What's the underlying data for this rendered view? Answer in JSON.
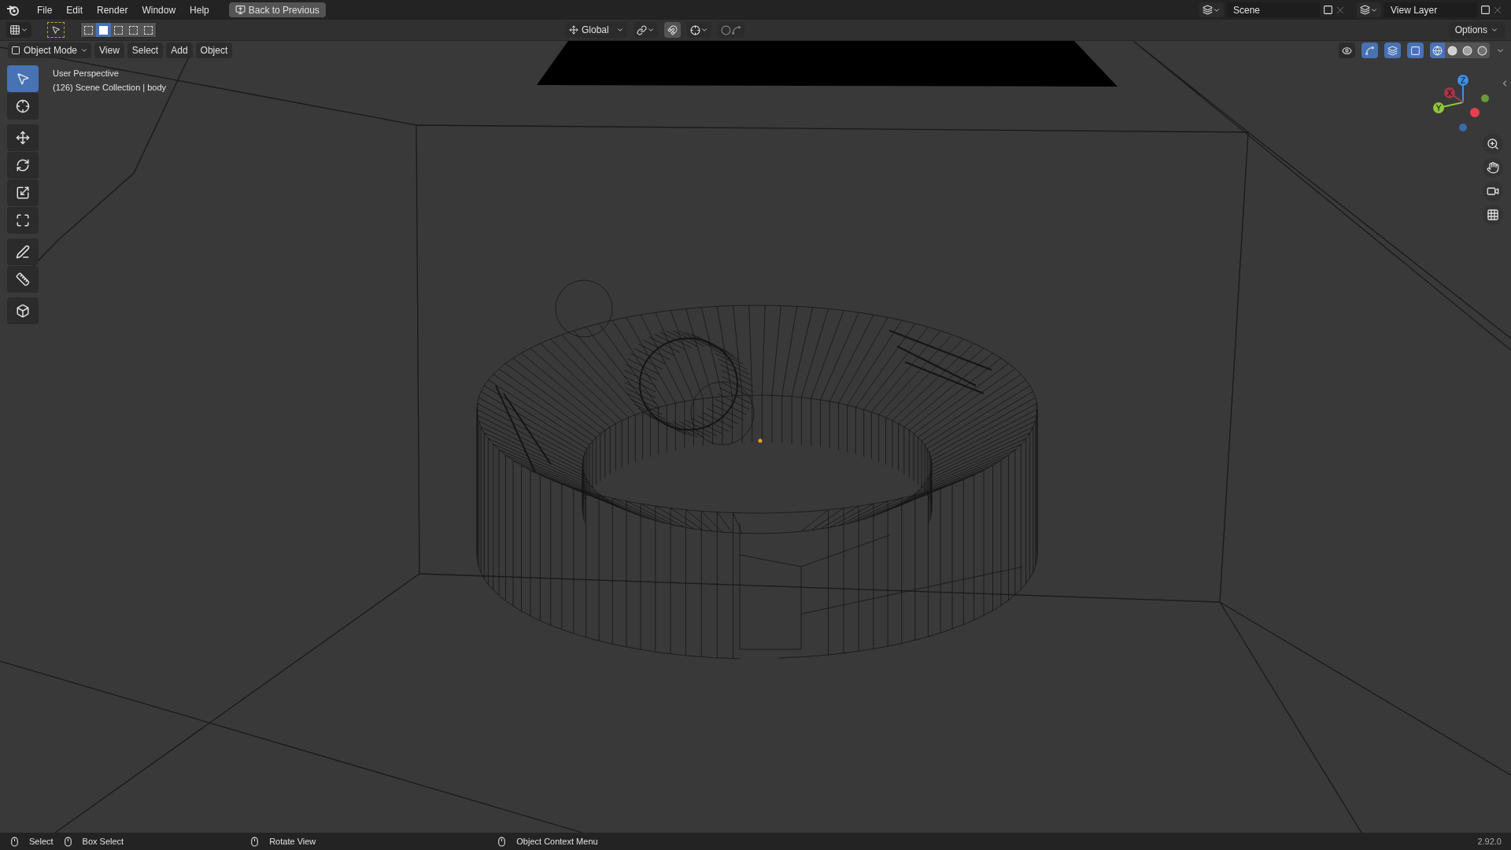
{
  "menu_bar": {
    "items": [
      "File",
      "Edit",
      "Render",
      "Window",
      "Help"
    ],
    "back_button": "Back to Previous",
    "scene": "Scene",
    "view_layer": "View Layer"
  },
  "tool_header": {
    "select_modes": [
      {
        "selected": false
      },
      {
        "selected": true
      },
      {
        "selected": false
      },
      {
        "selected": false
      },
      {
        "selected": false
      }
    ],
    "orientation": "Global",
    "options": "Options"
  },
  "viewport_header": {
    "mode": "Object Mode",
    "menus": [
      "View",
      "Select",
      "Add",
      "Object"
    ],
    "toggles": [
      {
        "kind": "visibility",
        "on": false
      },
      {
        "kind": "gizmos",
        "on": true
      },
      {
        "kind": "overlays",
        "on": true
      },
      {
        "kind": "xray",
        "on": true
      }
    ],
    "shading": [
      {
        "kind": "wireframe",
        "selected": true
      },
      {
        "kind": "solid",
        "selected": false
      },
      {
        "kind": "material",
        "selected": false
      },
      {
        "kind": "rendered",
        "selected": false
      }
    ]
  },
  "viewport": {
    "view_name": "User Perspective",
    "context": "(126) Scene Collection | body",
    "gizmo_axes": [
      "X",
      "Y",
      "Z"
    ]
  },
  "toolbar": {
    "tools": [
      {
        "kind": "select",
        "selected": true
      },
      {
        "kind": "cursor",
        "selected": false
      },
      {
        "kind": "move",
        "selected": false
      },
      {
        "kind": "rotate",
        "selected": false
      },
      {
        "kind": "scale",
        "selected": false
      },
      {
        "kind": "transform",
        "selected": false
      },
      {
        "kind": "annotate",
        "selected": false
      },
      {
        "kind": "measure",
        "selected": false
      },
      {
        "kind": "add_cube",
        "selected": false
      }
    ]
  },
  "status_bar": {
    "hints": [
      "Select",
      "Box Select",
      "Rotate View",
      "Object Context Menu"
    ],
    "version": "2.92.0"
  }
}
